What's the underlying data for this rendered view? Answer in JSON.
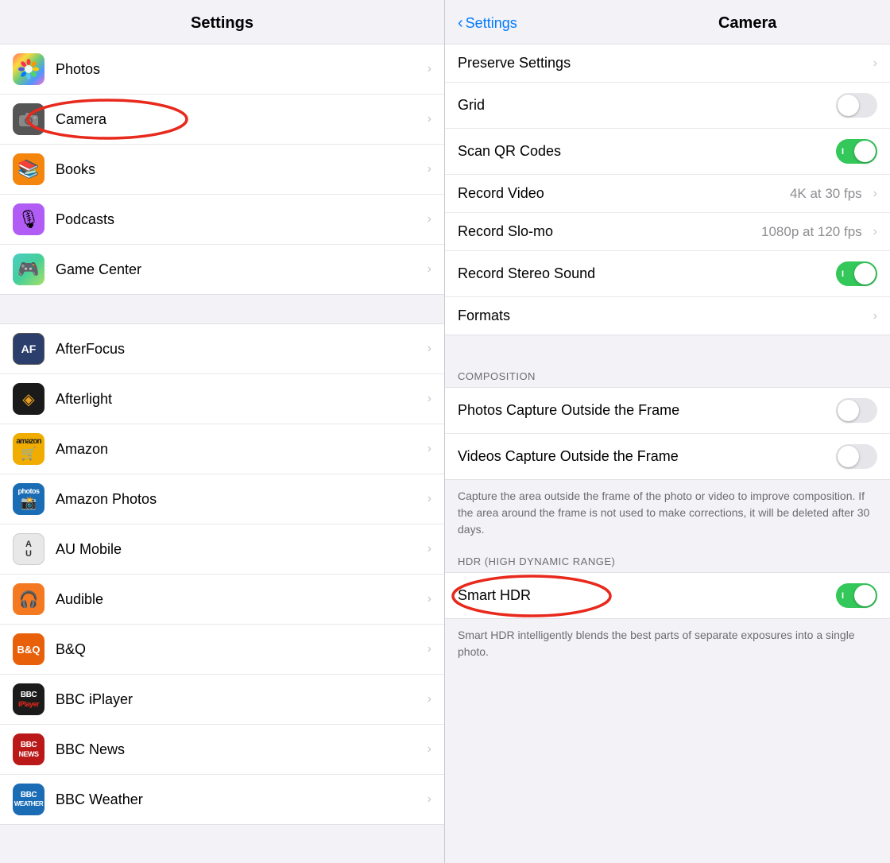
{
  "left": {
    "title": "Settings",
    "top_items": [
      {
        "id": "photos",
        "label": "Photos",
        "icon_class": "icon-photos",
        "icon_text": "🌸"
      },
      {
        "id": "camera",
        "label": "Camera",
        "icon_class": "icon-camera",
        "icon_text": "📷",
        "has_circle": true
      },
      {
        "id": "books",
        "label": "Books",
        "icon_class": "icon-books",
        "icon_text": "📖"
      },
      {
        "id": "podcasts",
        "label": "Podcasts",
        "icon_class": "icon-podcasts",
        "icon_text": "🎙"
      },
      {
        "id": "gamecenter",
        "label": "Game Center",
        "icon_class": "icon-gamecenter",
        "icon_text": "🎮"
      }
    ],
    "bottom_items": [
      {
        "id": "afterfocus",
        "label": "AfterFocus",
        "icon_class": "icon-afterfocus",
        "icon_text": "AF"
      },
      {
        "id": "afterlight",
        "label": "Afterlight",
        "icon_class": "icon-afterlight",
        "icon_text": "◈"
      },
      {
        "id": "amazon",
        "label": "Amazon",
        "icon_class": "icon-amazon",
        "icon_text": "🛒"
      },
      {
        "id": "amazonphotos",
        "label": "Amazon Photos",
        "icon_class": "icon-amazonphotos",
        "icon_text": "📷"
      },
      {
        "id": "aumobile",
        "label": "AU Mobile",
        "icon_class": "icon-aumobile",
        "icon_text": "AU"
      },
      {
        "id": "audible",
        "label": "Audible",
        "icon_class": "icon-audible",
        "icon_text": "🎧"
      },
      {
        "id": "bq",
        "label": "B&Q",
        "icon_class": "icon-bq",
        "icon_text": "B&Q"
      },
      {
        "id": "bbciplayer",
        "label": "BBC iPlayer",
        "icon_class": "icon-bbciplayer",
        "icon_text": "BBC"
      },
      {
        "id": "bbcnews",
        "label": "BBC News",
        "icon_class": "icon-bbcnews",
        "icon_text": "BBC"
      },
      {
        "id": "bbcweather",
        "label": "BBC Weather",
        "icon_class": "icon-bbcweather",
        "icon_text": "BBC"
      }
    ]
  },
  "right": {
    "back_label": "Settings",
    "title": "Camera",
    "top_settings": [
      {
        "id": "preserve_settings",
        "label": "Preserve Settings",
        "type": "chevron"
      },
      {
        "id": "grid",
        "label": "Grid",
        "type": "toggle",
        "value": false
      },
      {
        "id": "scan_qr",
        "label": "Scan QR Codes",
        "type": "toggle",
        "value": true
      },
      {
        "id": "record_video",
        "label": "Record Video",
        "type": "value_chevron",
        "value": "4K at 30 fps"
      },
      {
        "id": "record_slomo",
        "label": "Record Slo-mo",
        "type": "value_chevron",
        "value": "1080p at 120 fps"
      },
      {
        "id": "record_stereo",
        "label": "Record Stereo Sound",
        "type": "toggle",
        "value": true
      },
      {
        "id": "formats",
        "label": "Formats",
        "type": "chevron"
      }
    ],
    "composition_section": {
      "header": "COMPOSITION",
      "items": [
        {
          "id": "photos_capture",
          "label": "Photos Capture Outside the Frame",
          "type": "toggle",
          "value": false
        },
        {
          "id": "videos_capture",
          "label": "Videos Capture Outside the Frame",
          "type": "toggle",
          "value": false
        }
      ],
      "description": "Capture the area outside the frame of the photo or video to improve composition. If the area around the frame is not used to make corrections, it will be deleted after 30 days."
    },
    "hdr_section": {
      "header": "HDR (HIGH DYNAMIC RANGE)",
      "items": [
        {
          "id": "smart_hdr",
          "label": "Smart HDR",
          "type": "toggle",
          "value": true,
          "has_circle": true
        }
      ],
      "description": "Smart HDR intelligently blends the best parts of separate exposures into a single photo."
    }
  }
}
